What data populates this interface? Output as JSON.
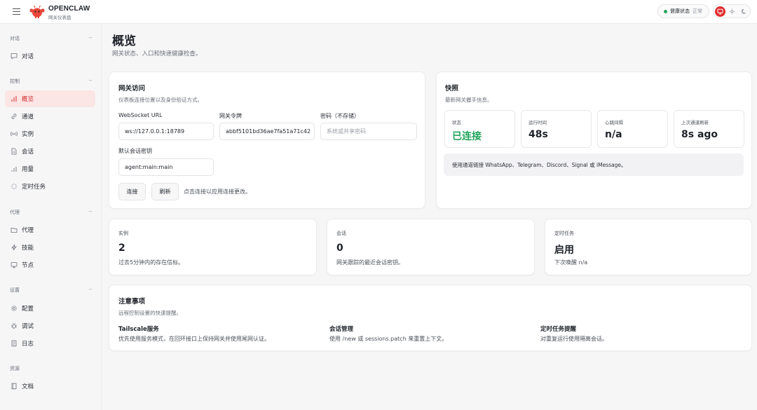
{
  "header": {
    "brand": "OPENCLAW",
    "brand_sub": "网关仪表盘",
    "health_label": "健康状态",
    "health_value": "正常"
  },
  "sidebar": {
    "sections": [
      {
        "title": "对话",
        "items": [
          {
            "label": "对话",
            "icon": "chat-icon"
          }
        ]
      },
      {
        "title": "控制",
        "items": [
          {
            "label": "概览",
            "icon": "bar-chart-icon",
            "active": true
          },
          {
            "label": "通道",
            "icon": "link-icon"
          },
          {
            "label": "实例",
            "icon": "radio-icon"
          },
          {
            "label": "会话",
            "icon": "document-icon"
          },
          {
            "label": "用量",
            "icon": "usage-icon"
          },
          {
            "label": "定时任务",
            "icon": "loader-icon"
          }
        ]
      },
      {
        "title": "代理",
        "items": [
          {
            "label": "代理",
            "icon": "folder-icon"
          },
          {
            "label": "技能",
            "icon": "bolt-icon"
          },
          {
            "label": "节点",
            "icon": "monitor-icon"
          }
        ]
      },
      {
        "title": "设置",
        "items": [
          {
            "label": "配置",
            "icon": "gear-icon"
          },
          {
            "label": "调试",
            "icon": "bug-icon"
          },
          {
            "label": "日志",
            "icon": "log-icon"
          }
        ]
      },
      {
        "title": "资源",
        "items": [
          {
            "label": "文档",
            "icon": "book-icon"
          }
        ]
      }
    ]
  },
  "main": {
    "title": "概览",
    "subtitle": "网关状态、入口和快速健康检查。"
  },
  "gateway": {
    "title": "网关访问",
    "subtitle": "仪表板连接位置以及身份验证方式。",
    "ws_label": "WebSocket URL",
    "ws_value": "ws://127.0.0.1:18789",
    "token_label": "网关令牌",
    "token_value": "abbf5101bd36ae7fa51a71c42",
    "password_label": "密码（不存储）",
    "password_placeholder": "系统或共享密码",
    "session_key_label": "默认会话密钥",
    "session_key_value": "agent:main:main",
    "connect_label": "连接",
    "refresh_label": "刷新",
    "hint": "点击连接以应用连接更改。"
  },
  "snapshot": {
    "title": "快照",
    "subtitle": "最新网关握手信息。",
    "stats": [
      {
        "label": "状态",
        "value": "已连接"
      },
      {
        "label": "运行时间",
        "value": "48s"
      },
      {
        "label": "心跳间隔",
        "value": "n/a"
      },
      {
        "label": "上次通道刷新",
        "value": "8s ago"
      }
    ],
    "banner": "使用通道链接 WhatsApp、Telegram、Discord、Signal 或 iMessage。"
  },
  "metrics": [
    {
      "label": "实例",
      "value": "2",
      "sub": "过去5分钟内的存在信标。"
    },
    {
      "label": "会话",
      "value": "0",
      "sub": "网关跟踪的最近会话密钥。"
    },
    {
      "label": "定时任务",
      "value": "启用",
      "sub": "下次唤醒 n/a"
    }
  ],
  "notes": {
    "title": "注意事项",
    "subtitle": "远程控制设置的快速提醒。",
    "items": [
      {
        "title": "Tailscale服务",
        "body": "优先使用服务模式，在回环接口上保持网关并使用尾网认证。"
      },
      {
        "title": "会话管理",
        "body": "使用 /new 或 sessions.patch 来重置上下文。"
      },
      {
        "title": "定时任务提醒",
        "body": "对重复运行使用隔离会话。"
      }
    ]
  },
  "colors": {
    "accent": "#e02d2d",
    "success": "#22a55b"
  }
}
